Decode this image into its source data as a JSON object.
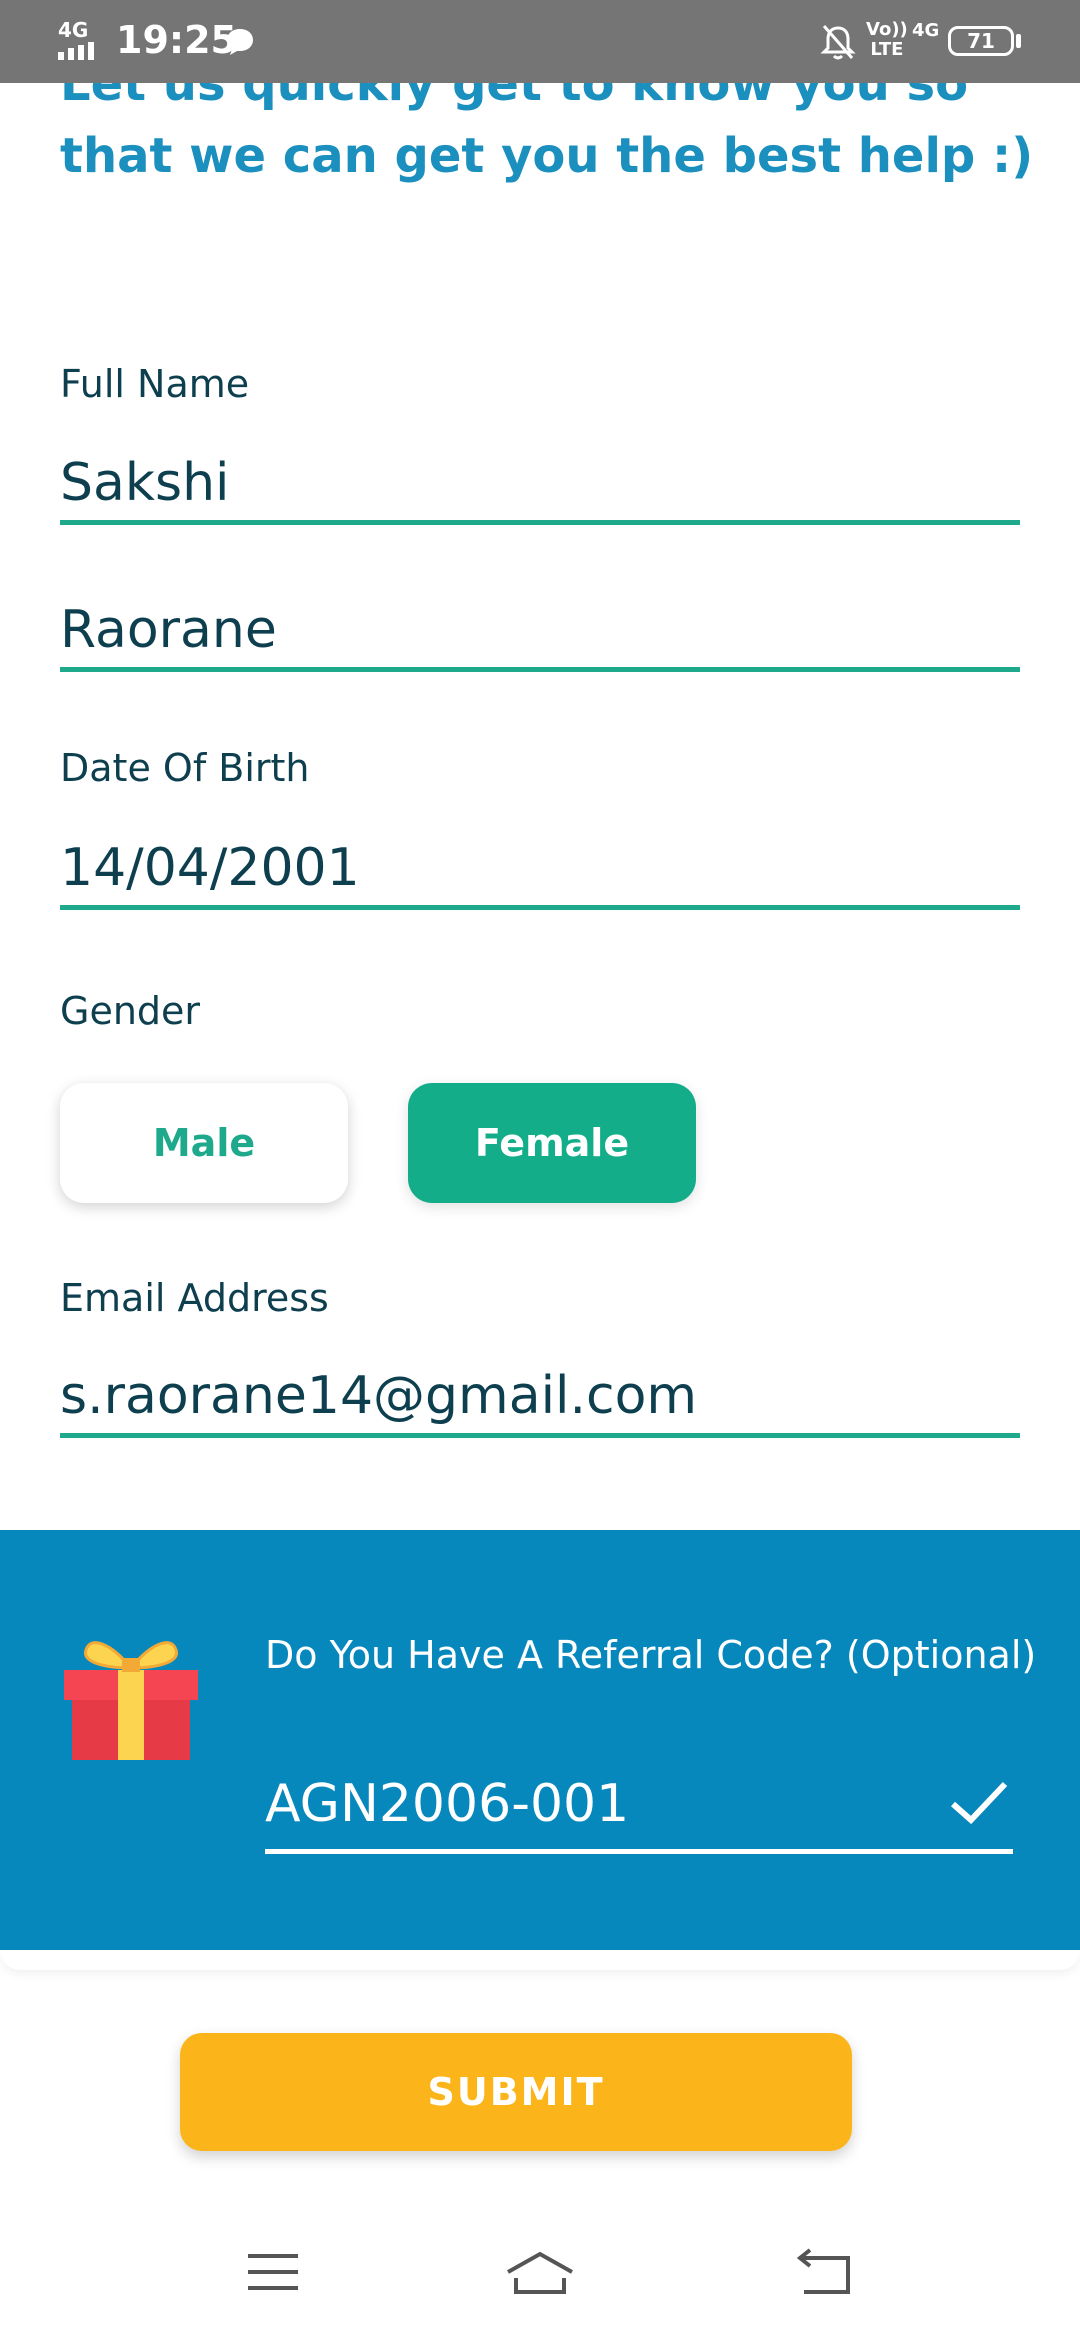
{
  "status_bar": {
    "network": "4G",
    "time": "19:25",
    "volte_top": "Vo))",
    "volte_bottom": "LTE",
    "network_right": "4G",
    "battery": "71",
    "icons": [
      "signal-icon",
      "chat-bubble-icon",
      "mute-bell-icon",
      "battery-icon"
    ]
  },
  "intro": {
    "text": "Let us quickly get to know you so that we can get you the best help :)"
  },
  "form": {
    "full_name_label": "Full Name",
    "first_name": "Sakshi",
    "last_name": "Raorane",
    "dob_label": "Date Of Birth",
    "dob": "14/04/2001",
    "gender_label": "Gender",
    "gender_options": [
      "Male",
      "Female"
    ],
    "gender_selected": "Female",
    "email_label": "Email Address",
    "email": "s.raorane14@gmail.com"
  },
  "referral": {
    "title": "Do You Have A Referral Code? (Optional)",
    "code": "AGN2006-001",
    "icons": [
      "gift-icon",
      "check-icon"
    ]
  },
  "actions": {
    "submit_label": "SUBMIT"
  },
  "navigation": {
    "icons": [
      "menu-icon",
      "home-icon",
      "back-icon"
    ]
  },
  "colors": {
    "accent_teal": "#1fa98c",
    "intro_blue": "#1b8fbd",
    "referral_blue": "#0688bd",
    "submit_yellow": "#fbb51b",
    "text_dark": "#0e3f4f",
    "status_gray": "#757575"
  }
}
